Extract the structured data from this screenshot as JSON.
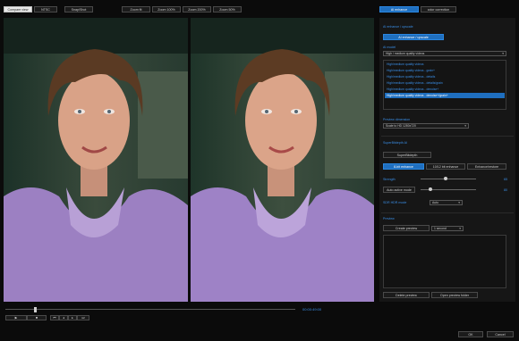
{
  "top_toolbar": {
    "compare_view": "Compare view",
    "ntsc": "NTSC",
    "snapshot": "Snap/Shot",
    "zoom_fit": "Zoom fit",
    "zoom_100": "Zoom 100%",
    "zoom_200": "Zoom 200%",
    "zoom_50": "Zoom 50%"
  },
  "tabs": {
    "ai_enhance": "AI enhance",
    "color_correction": "color correction"
  },
  "right_panel": {
    "section_title": "AI enhance / upscale",
    "enhance_button": "AI enhance / upscale",
    "ai_model_label": "AI model",
    "ai_model_value": "High / medium quality videos",
    "model_list": [
      "High/medium quality videos",
      "High/medium quality videos - grain+",
      "High/medium quality videos - details",
      "High/medium quality videos - details/grain",
      "High/medium quality videos - denoise+",
      "High/medium quality videos - denoise+/grain+"
    ],
    "selected_index": 5,
    "preview_dimension_label": "Preview dimension",
    "preview_dimension_value": "Scale to HD 1280x720",
    "superbitdepth_label": "SuperBitdepth AI",
    "superbitdepth_button": "SuperBitdepth",
    "subtabs": [
      "8-bit enhance",
      "10/12 bit enhance",
      "Enhance/restore"
    ],
    "strength_label": "Strength",
    "strength_value": "65",
    "strength_level": 0.45,
    "active_mode_button": "Auto active mode",
    "active_mode_value": "80",
    "active_mode_level": 0.15,
    "sdr_hdr_label": "SDR HDR mode",
    "sdr_hdr_value": "Auto",
    "preview_label": "Preview",
    "create_preview": "Create preview",
    "duration_value": "1 second",
    "delete_preview": "Delete preview",
    "open_preview_folder": "Open preview folder"
  },
  "timeline": {
    "timecode": "00:00:49:00",
    "position": 0.1
  },
  "footer": {
    "ok": "OK",
    "cancel": "Cancel"
  },
  "colors": {
    "accent": "#1f6fbf",
    "accent_text": "#3a8ee6",
    "background": "#0b0b0b",
    "panel": "#161616"
  }
}
